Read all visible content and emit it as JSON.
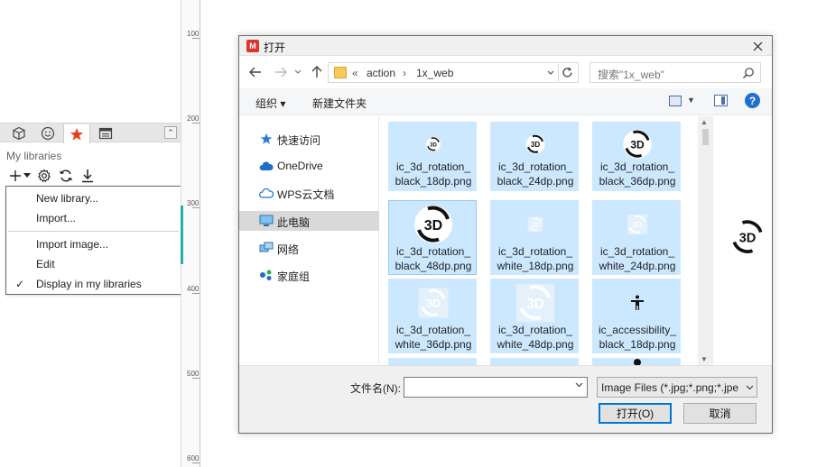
{
  "left_panel": {
    "section_label": "My libraries",
    "menu": {
      "items": [
        {
          "label": "New library..."
        },
        {
          "label": "Import..."
        },
        {
          "label": "Import image..."
        },
        {
          "label": "Edit"
        },
        {
          "label": "Display in my libraries",
          "checked": true
        }
      ],
      "check_glyph": "✓"
    },
    "ruler_labels": [
      "100",
      "200",
      "300",
      "400",
      "500",
      "600"
    ],
    "accent_color": "#23b3a6",
    "star_color": "#e8401c"
  },
  "dialog": {
    "title": "打开",
    "app_icon_letter": "M",
    "app_icon_color": "#d9372b",
    "breadcrumb": {
      "separator": "«",
      "items": [
        "action",
        "1x_web"
      ],
      "arrow": "›"
    },
    "search_placeholder": "搜索\"1x_web\"",
    "commands": {
      "organize": "组织 ▾",
      "new_folder": "新建文件夹"
    },
    "nav_items": [
      {
        "label": "快速访问",
        "icon": "star-icon"
      },
      {
        "label": "OneDrive",
        "icon": "cloud-icon"
      },
      {
        "label": "WPS云文档",
        "icon": "cloud-outline-icon"
      },
      {
        "label": "此电脑",
        "icon": "computer-icon",
        "selected": true
      },
      {
        "label": "网络",
        "icon": "network-icon"
      },
      {
        "label": "家庭组",
        "icon": "homegroup-icon"
      }
    ],
    "files": [
      {
        "line1": "ic_3d_rotation_",
        "line2": "black_18dp.png",
        "variant": "black",
        "size": 18
      },
      {
        "line1": "ic_3d_rotation_",
        "line2": "black_24dp.png",
        "variant": "black",
        "size": 24
      },
      {
        "line1": "ic_3d_rotation_",
        "line2": "black_36dp.png",
        "variant": "black",
        "size": 36
      },
      {
        "line1": "ic_3d_rotation_",
        "line2": "black_48dp.png",
        "variant": "black",
        "size": 48
      },
      {
        "line1": "ic_3d_rotation_",
        "line2": "white_18dp.png",
        "variant": "white",
        "size": 18
      },
      {
        "line1": "ic_3d_rotation_",
        "line2": "white_24dp.png",
        "variant": "white",
        "size": 24
      },
      {
        "line1": "ic_3d_rotation_",
        "line2": "white_36dp.png",
        "variant": "white",
        "size": 36
      },
      {
        "line1": "ic_3d_rotation_",
        "line2": "white_48dp.png",
        "variant": "white",
        "size": 48
      },
      {
        "line1": "ic_accessibility_",
        "line2": "black_18dp.png",
        "variant": "accessibility",
        "size": 18
      }
    ],
    "selection_color": "#cce8ff",
    "filename_label": "文件名(N):",
    "filename_value": "",
    "filetype_value": "Image Files (*.jpg;*.png;*.jpe",
    "open_button": "打开(O)",
    "cancel_button": "取消"
  }
}
